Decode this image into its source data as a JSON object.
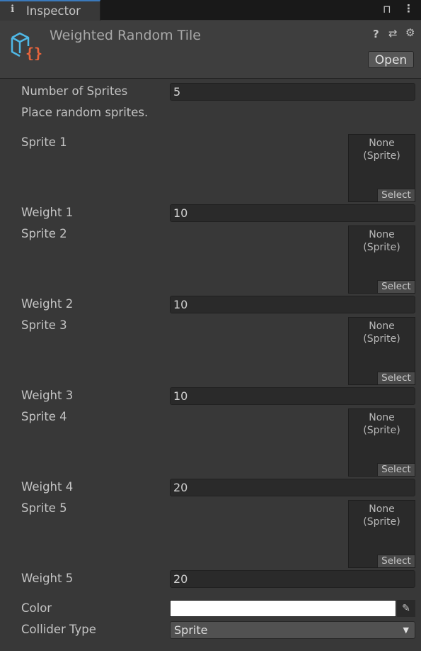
{
  "window": {
    "tab_label": "Inspector"
  },
  "header": {
    "title": "Weighted Random Tile",
    "open_label": "Open"
  },
  "fields": {
    "number_of_sprites": {
      "label": "Number of Sprites",
      "value": "5"
    },
    "help_text": "Place random sprites.",
    "sprites": [
      {
        "sprite_label": "Sprite 1",
        "object": "None",
        "type": "(Sprite)",
        "select": "Select",
        "weight_label": "Weight 1",
        "weight": "10"
      },
      {
        "sprite_label": "Sprite 2",
        "object": "None",
        "type": "(Sprite)",
        "select": "Select",
        "weight_label": "Weight 2",
        "weight": "10"
      },
      {
        "sprite_label": "Sprite 3",
        "object": "None",
        "type": "(Sprite)",
        "select": "Select",
        "weight_label": "Weight 3",
        "weight": "10"
      },
      {
        "sprite_label": "Sprite 4",
        "object": "None",
        "type": "(Sprite)",
        "select": "Select",
        "weight_label": "Weight 4",
        "weight": "20"
      },
      {
        "sprite_label": "Sprite 5",
        "object": "None",
        "type": "(Sprite)",
        "select": "Select",
        "weight_label": "Weight 5",
        "weight": "20"
      }
    ],
    "color": {
      "label": "Color",
      "value": "#ffffff"
    },
    "collider_type": {
      "label": "Collider Type",
      "value": "Sprite"
    }
  },
  "colors": {
    "accent": "#3a79bb",
    "icon_blue": "#4fb8e6",
    "icon_orange": "#e8643c"
  }
}
